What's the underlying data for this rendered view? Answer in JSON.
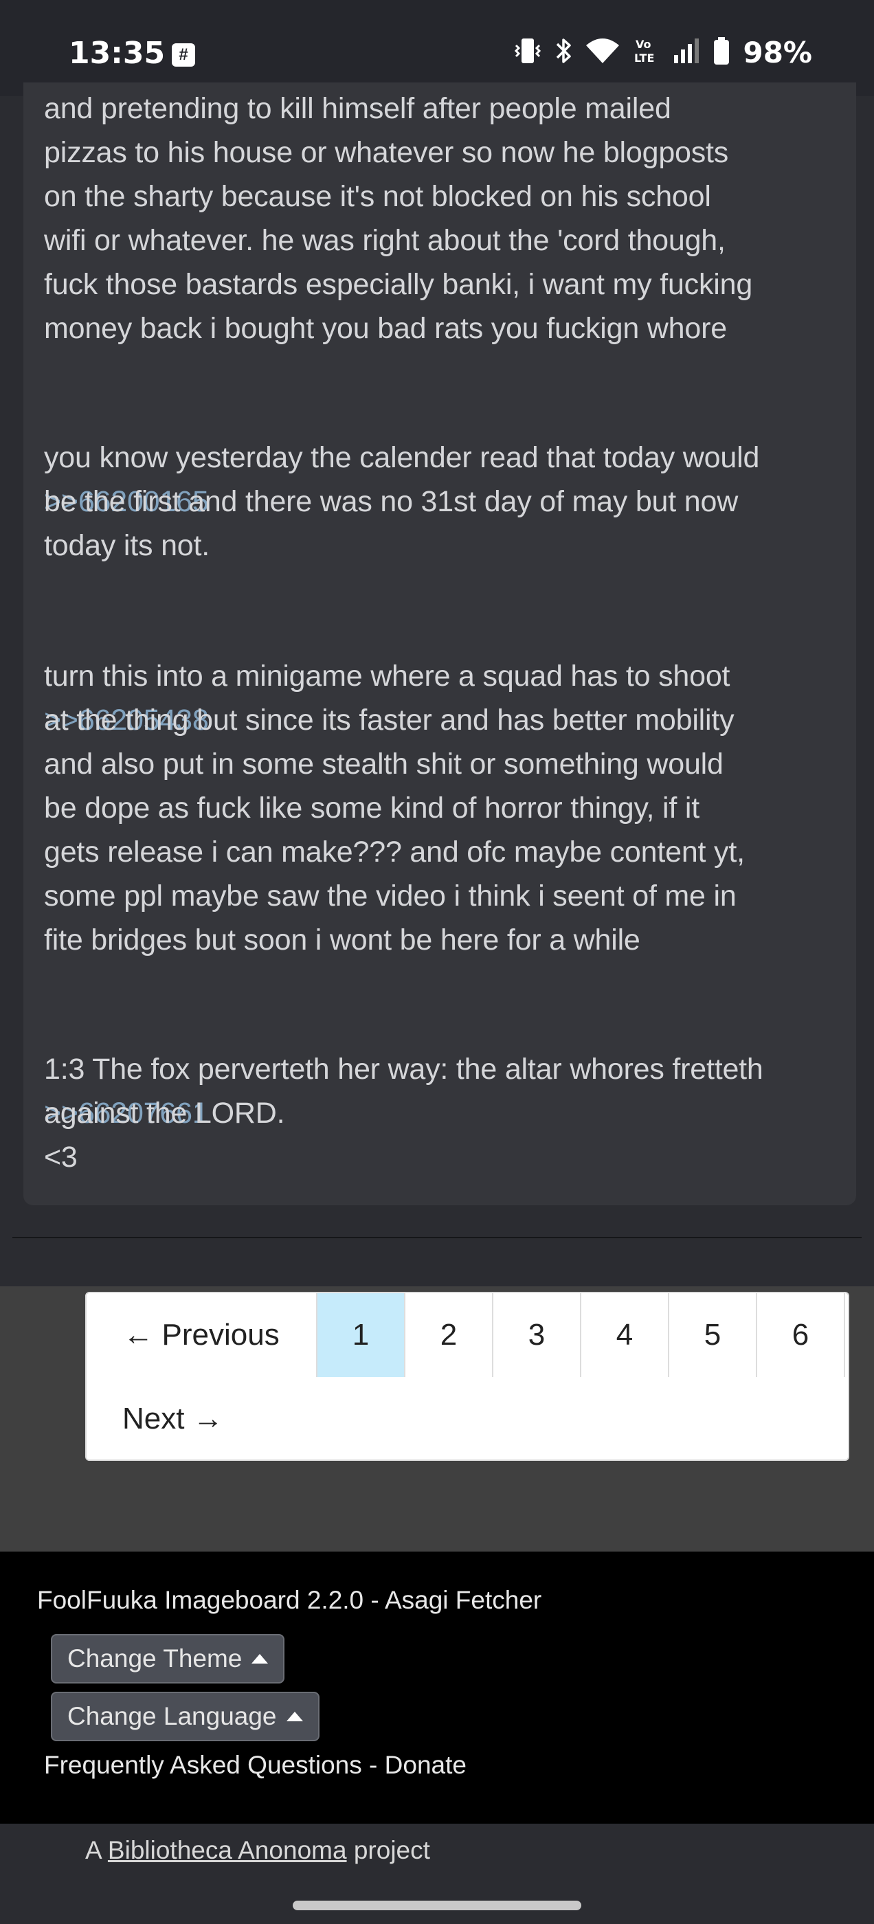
{
  "status_bar": {
    "time": "13:35",
    "notification_icon": "hash-notification-icon",
    "icons": [
      "vibrate-icon",
      "bluetooth-icon",
      "wifi-icon",
      "volte-icon",
      "signal-icon",
      "battery-icon"
    ],
    "volte_label": "Vo\nLTE",
    "battery_percent": "98%"
  },
  "post": {
    "paragraph_1": "and pretending to kill himself after people mailed\npizzas to his house or whatever so now he blogposts\non the sharty because it's not blocked on his school\nwifi or whatever. he was right about the 'cord though,\nfuck those bastards especially banki, i want my fucking\nmoney back i bought you bad rats you fuckign whore",
    "quote_1": ">>66200165",
    "paragraph_2": "you know yesterday the calender read that today would\nbe the first and there was no 31st day of may but now\ntoday its not.",
    "quote_2": ">>66205438",
    "paragraph_3": "turn this into a minigame where a squad has to shoot\nat the thing but since its faster and has better mobility\nand also put in some stealth shit or something would\nbe dope as fuck like some kind of horror thingy, if it\ngets release i can make??? and ofc maybe content yt,\nsome ppl maybe saw the video i think i seent of me in\nfite bridges but soon i wont be here for a while",
    "quote_3": ">>66207661",
    "paragraph_4": "1:3 The fox perverteth her way: the altar whores fretteth\nagainst the LORD.\n<3"
  },
  "pagination": {
    "previous_label": "← Previous",
    "pages": [
      "1",
      "2",
      "3",
      "4",
      "5",
      "6"
    ],
    "active_page": "1",
    "next_label": "Next →"
  },
  "footer": {
    "credit": "FoolFuuka Imageboard 2.2.0 - Asagi Fetcher",
    "change_theme_label": "Change Theme",
    "change_language_label": "Change Language",
    "faq_label": "Frequently Asked Questions",
    "separator": " - ",
    "donate_label": "Donate",
    "project_prefix": "A ",
    "project_link": "Bibliotheca Anonoma",
    "project_suffix": " project"
  },
  "colors": {
    "background": "#2b2c31",
    "card": "#35363b",
    "quote_link": "#81a2be",
    "active_page": "#c6ebfb",
    "footer_bg": "#000000"
  }
}
